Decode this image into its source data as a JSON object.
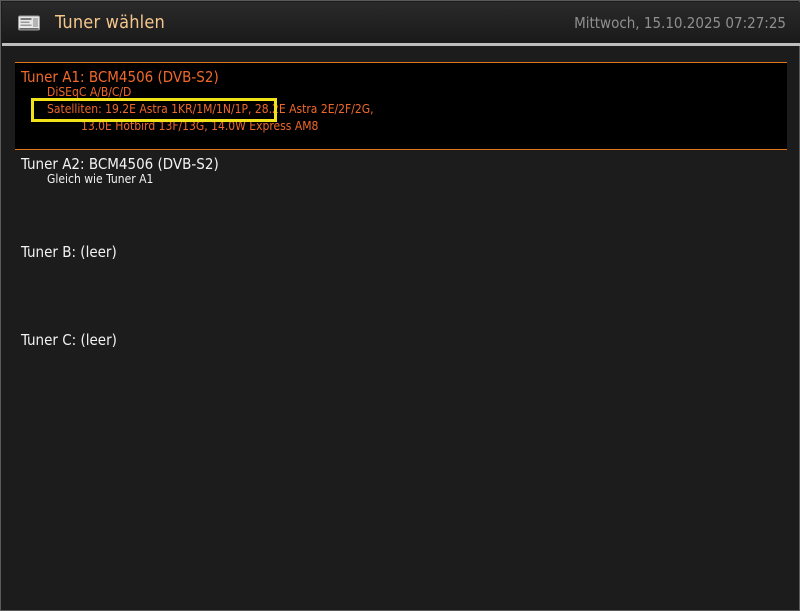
{
  "header": {
    "title": "Tuner wählen",
    "datetime": "Mittwoch, 15.10.2025  07:27:25",
    "icon": "tuner-setup-icon"
  },
  "tuners": [
    {
      "title": "Tuner A1: BCM4506 (DVB-S2)",
      "lines": [
        "DiSEqC A/B/C/D",
        "Satelliten: 19.2E Astra 1KR/1M/1N/1P, 28.2E Astra 2E/2F/2G,",
        "13.0E Hotbird 13F/13G, 14.0W Express AM8"
      ],
      "selected": true
    },
    {
      "title": "Tuner A2: BCM4506 (DVB-S2)",
      "lines": [
        "Gleich wie Tuner A1"
      ],
      "selected": false
    },
    {
      "title": "Tuner B: (leer)",
      "lines": [],
      "selected": false
    },
    {
      "title": "Tuner C: (leer)",
      "lines": [],
      "selected": false
    }
  ],
  "colors": {
    "background": "#1c1c1c",
    "header_title": "#f4c68c",
    "selected_text": "#f0682a",
    "selection_border": "#e2761c",
    "highlight_box": "#f2e21a"
  }
}
